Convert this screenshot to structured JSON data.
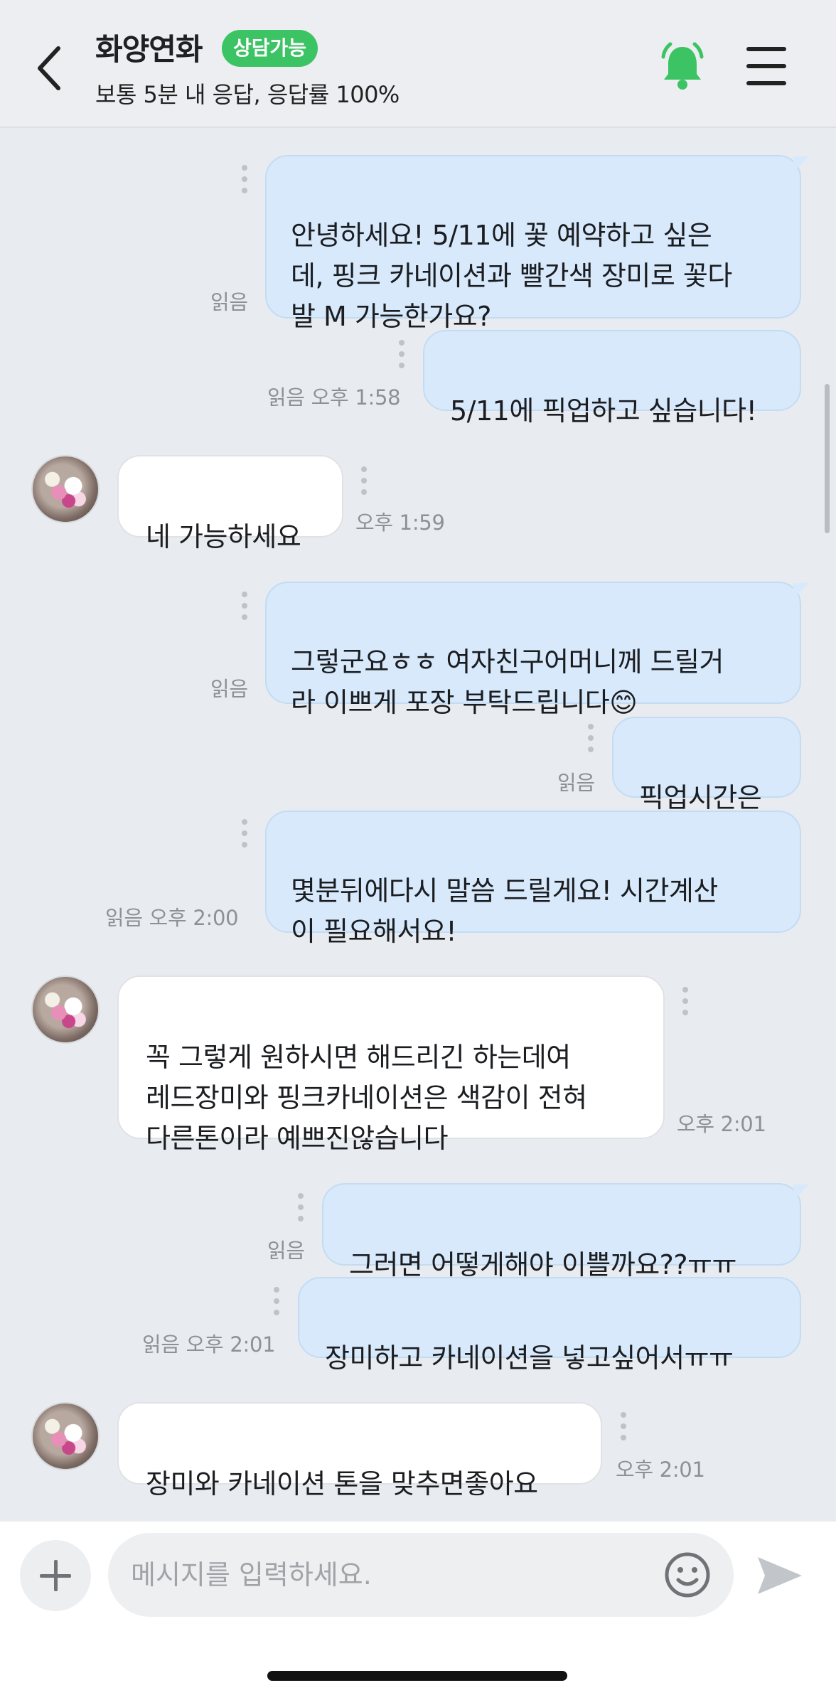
{
  "header": {
    "title": "화양연화",
    "status_badge": "상담가능",
    "subtitle": "보통 5분 내 응답, 응답률 100%",
    "colors": {
      "badge": "#3cc364",
      "bell": "#3cc364"
    }
  },
  "messages": [
    {
      "side": "out",
      "text": "안녕하세요! 5/11에 꽃 예약하고 싶은\n데, 핑크 카네이션과 빨간색 장미로 꽃다\n발 M 가능한가요?",
      "meta": "읽음"
    },
    {
      "side": "out",
      "text": "5/11에 픽업하고 싶습니다!",
      "meta": "읽음 오후 1:58"
    },
    {
      "side": "in",
      "text": "네 가능하세요",
      "meta": "오후 1:59"
    },
    {
      "side": "out",
      "text": "그렇군요ㅎㅎ 여자친구어머니께 드릴거\n라 이쁘게 포장 부탁드립니다",
      "emoji": "😊",
      "meta": "읽음"
    },
    {
      "side": "out",
      "text": "픽업시간은",
      "meta": "읽음"
    },
    {
      "side": "out",
      "text": "몇분뒤에다시 말씀 드릴게요! 시간계산\n이 필요해서요!",
      "meta": "읽음 오후 2:00"
    },
    {
      "side": "in",
      "text": "꼭 그렇게 원하시면 해드리긴 하는데여\n레드장미와 핑크카네이션은 색감이 전혀\n다른톤이라 예쁘진않습니다",
      "meta": "오후 2:01"
    },
    {
      "side": "out",
      "text": "그러면 어떻게해야 이쁠까요??ㅠㅠ",
      "meta": "읽음"
    },
    {
      "side": "out",
      "text": "장미하고 카네이션을 넣고싶어서ㅠㅠ",
      "meta": "읽음 오후 2:01"
    },
    {
      "side": "in",
      "text": "장미와 카네이션 톤을 맞추면좋아요",
      "meta": "오후 2:01"
    }
  ],
  "composer": {
    "placeholder": "메시지를 입력하세요.",
    "icons": [
      "plus-icon",
      "emoji-icon",
      "send-icon"
    ]
  },
  "header_icons": [
    "back-arrow-icon",
    "bell-icon",
    "hamburger-menu-icon"
  ]
}
